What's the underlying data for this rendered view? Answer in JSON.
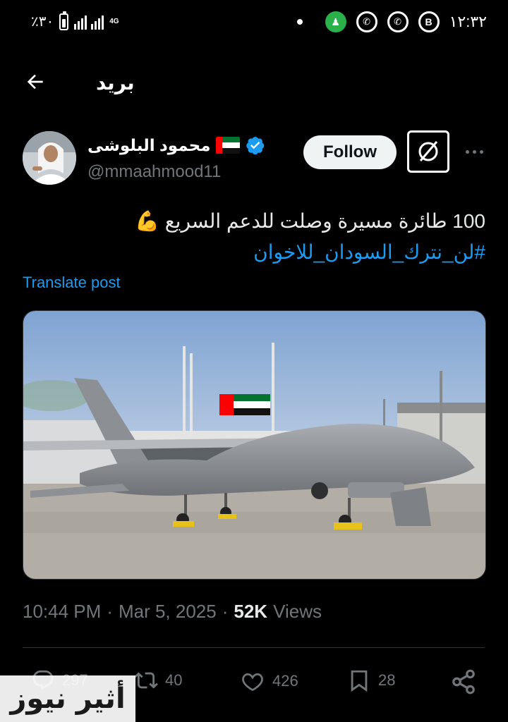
{
  "status_bar": {
    "battery_text": "٪٣٠",
    "network": "4G",
    "time": "١٢:٣٢",
    "icons": [
      "dot-icon",
      "app-icon-green",
      "whatsapp-icon",
      "whatsapp-icon",
      "b-app-icon"
    ]
  },
  "header": {
    "title": "بريد",
    "back_icon": "arrow-left-icon"
  },
  "author": {
    "name": "محمود البلوشى",
    "handle": "@mmaahmood11",
    "flag": "uae-flag-icon",
    "verified": true
  },
  "follow_label": "Follow",
  "tweet": {
    "text": "100 طائرة مسيرة وصلت للدعم السريع 💪",
    "hashtag": "#لن_نترك_السودان_للاخوان",
    "translate_label": "Translate post"
  },
  "media": {
    "description_icon": "drone-photo"
  },
  "meta": {
    "time": "10:44 PM",
    "sep": "·",
    "date": "Mar 5, 2025",
    "views_count": "52K",
    "views_label": "Views"
  },
  "actions": {
    "replies": "297",
    "reposts": "40",
    "likes": "426",
    "bookmarks": "28"
  },
  "watermark": {
    "text": "أثير نيوز"
  },
  "colors": {
    "accent": "#1d9bf0",
    "muted": "#71767b",
    "background": "#000000"
  }
}
